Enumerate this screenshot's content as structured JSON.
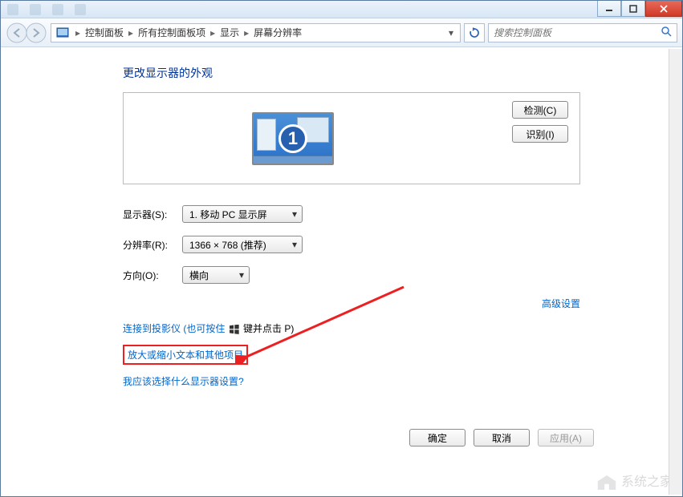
{
  "breadcrumb": {
    "items": [
      "控制面板",
      "所有控制面板项",
      "显示",
      "屏幕分辨率"
    ]
  },
  "search": {
    "placeholder": "搜索控制面板"
  },
  "page": {
    "title": "更改显示器的外观"
  },
  "preview": {
    "monitor_number": "1",
    "detect_label": "检测(C)",
    "identify_label": "识别(I)"
  },
  "form": {
    "display_label": "显示器(S):",
    "display_value": "1. 移动 PC 显示屏",
    "resolution_label": "分辨率(R):",
    "resolution_value": "1366 × 768 (推荐)",
    "orientation_label": "方向(O):",
    "orientation_value": "横向"
  },
  "links": {
    "advanced": "高级设置",
    "projector": "连接到投影仪 (也可按住 ",
    "projector_suffix": " 键并点击 P)",
    "text_scale": "放大或缩小文本和其他项目",
    "which_display": "我应该选择什么显示器设置?"
  },
  "buttons": {
    "ok": "确定",
    "cancel": "取消",
    "apply": "应用(A)"
  },
  "watermark": "系统之家"
}
